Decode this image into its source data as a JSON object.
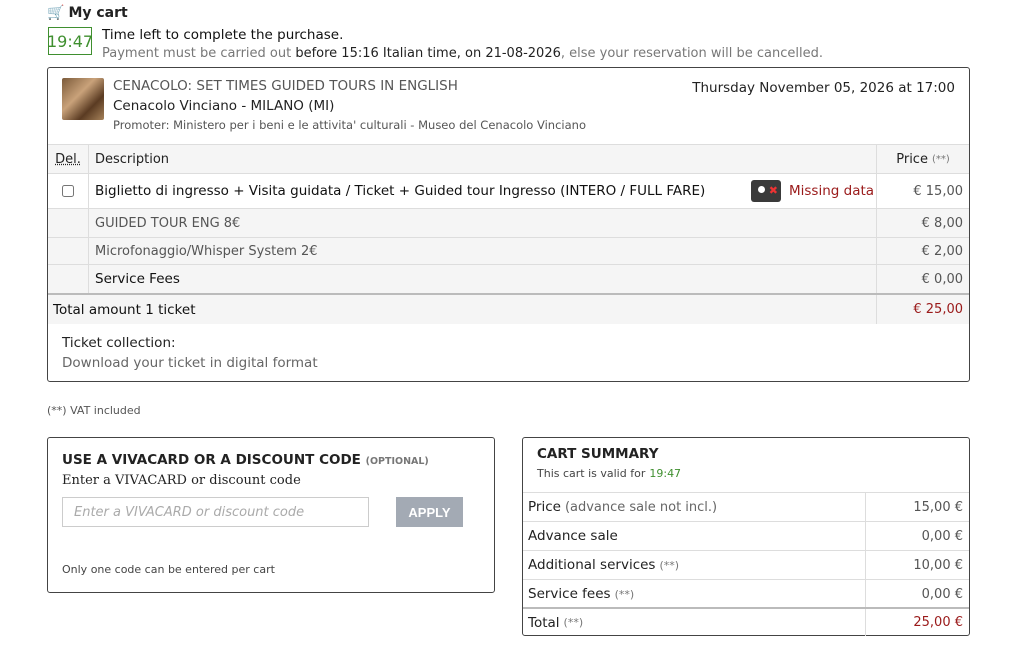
{
  "header": {
    "title": "My cart"
  },
  "timer": {
    "value": "19:47",
    "label": "Time left to complete the purchase.",
    "payment_prefix": "Payment must be carried out ",
    "payment_bold": "before 15:16 Italian time, on 21-08-2026",
    "payment_suffix": ", else your reservation will be cancelled."
  },
  "event": {
    "title": "CENACOLO: SET TIMES GUIDED TOURS IN ENGLISH",
    "venue": "Cenacolo Vinciano - MILANO (MI)",
    "promoter": "Promoter: Ministero per i beni e le attivita' culturali - Museo del Cenacolo Vinciano",
    "date": "Thursday November 05, 2026 at 17:00"
  },
  "table": {
    "col_del": "Del.",
    "col_description": "Description",
    "col_price": "Price",
    "col_price_note": "(**)",
    "item": {
      "description": "Biglietto di ingresso + Visita guidata / Ticket + Guided tour Ingresso (INTERO / FULL FARE)",
      "status": "Missing data",
      "price": "€ 15,00"
    },
    "extras": [
      {
        "description": "GUIDED TOUR ENG 8€",
        "price": "€ 8,00"
      },
      {
        "description": "Microfonaggio/Whisper System 2€",
        "price": "€ 2,00"
      }
    ],
    "fees": {
      "description": "Service Fees",
      "price": "€ 0,00"
    },
    "total": {
      "description": "Total amount 1 ticket",
      "price": "€ 25,00"
    }
  },
  "collection": {
    "title": "Ticket collection:",
    "text": "Download your ticket in digital format"
  },
  "vat_note": "(**) VAT included",
  "discount": {
    "title": "USE A VIVACARD OR A DISCOUNT CODE",
    "optional": "(OPTIONAL)",
    "subtitle": "Enter a VIVACARD or discount code",
    "placeholder": "Enter a VIVACARD or discount code",
    "apply": "APPLY",
    "note": "Only one code can be entered per cart"
  },
  "summary": {
    "title": "CART SUMMARY",
    "valid_label": "This cart is valid for",
    "valid_time": "19:47",
    "rows": [
      {
        "label": "Price",
        "note": "(advance sale not incl.)",
        "value": "15,00 €"
      },
      {
        "label": "Advance sale",
        "note": "",
        "value": "0,00 €"
      },
      {
        "label": "Additional services",
        "note": "(**)",
        "value": "10,00 €"
      },
      {
        "label": "Service fees",
        "note": "(**)",
        "value": "0,00 €"
      }
    ],
    "total": {
      "label": "Total",
      "note": "(**)",
      "value": "25,00 €"
    }
  },
  "colors": {
    "timer_green": "#3f8f2f",
    "alert_red": "#9a1a1a"
  }
}
